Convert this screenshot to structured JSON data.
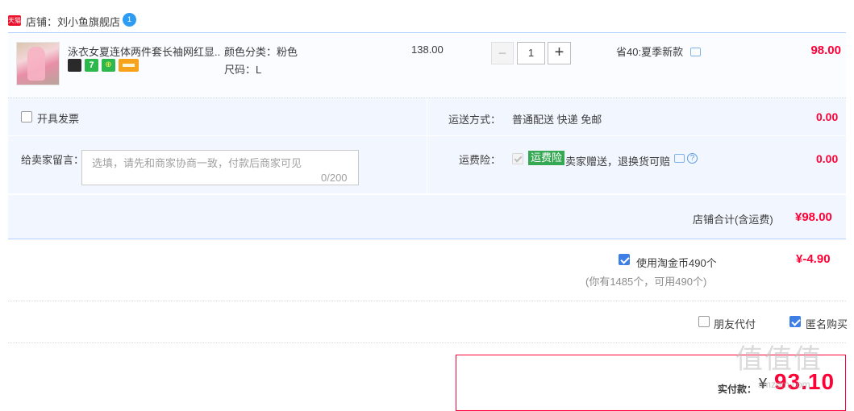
{
  "store": {
    "badge": "天猫",
    "label": "店铺：刘小鱼旗舰店",
    "wangwang_badge": "1"
  },
  "item": {
    "title": "泳衣女夏连体两件套长袖网红显...",
    "badge_icons": [
      "cat-icon",
      "seven-day-return-icon",
      "shield-guarantee-icon",
      "credit-card-icon"
    ],
    "badge_seven": "7",
    "badge_shield": "⊕",
    "sku_color": "颜色分类：粉色",
    "sku_size": "尺码：L",
    "unit_price": "138.00",
    "quantity": "1",
    "minus": "−",
    "plus": "+",
    "promo": "省40:夏季新款",
    "subtotal": "98.00"
  },
  "options": {
    "invoice_label": "开具发票",
    "shipping_label": "运送方式：",
    "shipping_value": "普通配送 快递 免邮",
    "shipping_amount": "0.00",
    "message_label": "给卖家留言：",
    "message_placeholder": "选填，请先和商家协商一致，付款后商家可见",
    "message_count": "0/200",
    "insurance_label": "运费险：",
    "insurance_tag": "运费险",
    "insurance_desc": "卖家赠送，退换货可赔",
    "insurance_help": "?",
    "insurance_amount": "0.00"
  },
  "store_total": {
    "label": "店铺合计(含运费)",
    "value": "¥98.00"
  },
  "coins": {
    "label": "使用淘金币490个",
    "sub": "(你有1485个，可用490个)",
    "value": "¥-4.90"
  },
  "purchase_options": {
    "friend_pay": "朋友代付",
    "anonymous": "匿名购买"
  },
  "payment": {
    "label": "实付款：",
    "yen": "¥",
    "amount": "93.10"
  },
  "watermark": {
    "text": "值值值",
    "sub": "smzdm.com"
  },
  "colors": {
    "accent_red": "#ff0036",
    "tmall_red": "#e8102b",
    "option_bg": "#f2f7ff",
    "border_blue": "#b2d1ff",
    "checkbox_blue": "#3d7fe6",
    "insurance_green": "#34a853"
  }
}
